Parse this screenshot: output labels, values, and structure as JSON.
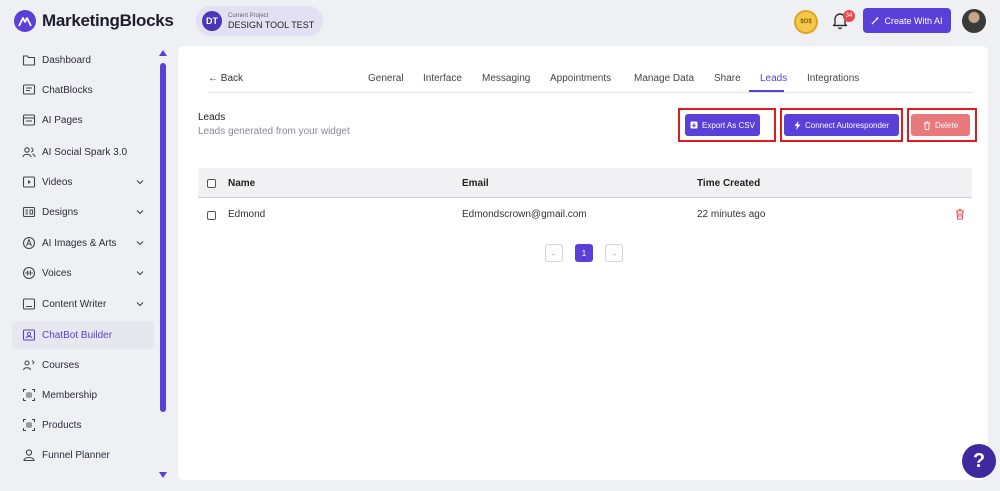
{
  "brand": {
    "name": "MarketingBlocks",
    "color": "#5b3fd9"
  },
  "project": {
    "initials": "DT",
    "caption": "Current Project",
    "name": "DESIGN TOOL TEST"
  },
  "header": {
    "coin_label": "$O$",
    "notifications_count": "34",
    "create_label": "Create With AI"
  },
  "sidebar": {
    "items": [
      {
        "label": "Dashboard",
        "icon": "folder-icon",
        "has_chevron": false,
        "active": false
      },
      {
        "label": "ChatBlocks",
        "icon": "chat-icon",
        "has_chevron": false,
        "active": false
      },
      {
        "label": "AI Pages",
        "icon": "page-icon",
        "has_chevron": false,
        "active": false
      },
      {
        "label": "AI Social Spark 3.0",
        "icon": "users-icon",
        "has_chevron": false,
        "active": false
      },
      {
        "label": "Videos",
        "icon": "video-icon",
        "has_chevron": true,
        "active": false
      },
      {
        "label": "Designs",
        "icon": "design-icon",
        "has_chevron": true,
        "active": false
      },
      {
        "label": "AI Images & Arts",
        "icon": "art-icon",
        "has_chevron": true,
        "active": false
      },
      {
        "label": "Voices",
        "icon": "voice-icon",
        "has_chevron": true,
        "active": false
      },
      {
        "label": "Content Writer",
        "icon": "writer-icon",
        "has_chevron": true,
        "active": false
      },
      {
        "label": "ChatBot Builder",
        "icon": "chatbot-icon",
        "has_chevron": false,
        "active": true
      },
      {
        "label": "Courses",
        "icon": "courses-icon",
        "has_chevron": false,
        "active": false
      },
      {
        "label": "Membership",
        "icon": "membership-icon",
        "has_chevron": false,
        "active": false
      },
      {
        "label": "Products",
        "icon": "products-icon",
        "has_chevron": false,
        "active": false
      },
      {
        "label": "Funnel Planner",
        "icon": "funnel-icon",
        "has_chevron": false,
        "active": false
      }
    ]
  },
  "main": {
    "back_label": "← Back",
    "tabs": [
      {
        "label": "General",
        "active": false
      },
      {
        "label": "Interface",
        "active": false
      },
      {
        "label": "Messaging",
        "active": false
      },
      {
        "label": "Appointments",
        "active": false
      },
      {
        "label": "Manage Data",
        "active": false
      },
      {
        "label": "Share",
        "active": false
      },
      {
        "label": "Leads",
        "active": true
      },
      {
        "label": "Integrations",
        "active": false
      }
    ],
    "section_title": "Leads",
    "section_subtitle": "Leads generated from your widget",
    "actions": {
      "export_label": "Export As CSV",
      "connect_label": "Connect Autoresponder",
      "delete_label": "Delete"
    },
    "table": {
      "columns": [
        "Name",
        "Email",
        "Time Created"
      ],
      "rows": [
        {
          "name": "Edmond",
          "email": "Edmondscrown@gmail.com",
          "time": "22 minutes ago"
        }
      ]
    },
    "pagination": {
      "prev": "←",
      "current": "1",
      "next": "→"
    }
  },
  "help_label": "?"
}
